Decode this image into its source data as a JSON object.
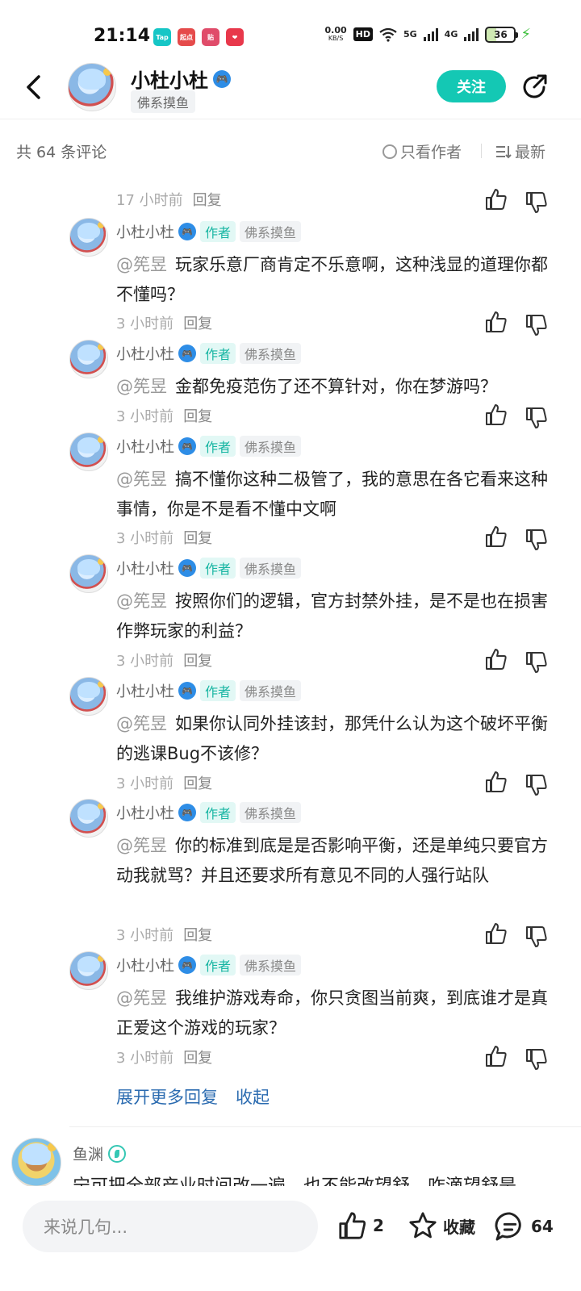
{
  "status_bar": {
    "time": "21:14",
    "apps": [
      {
        "name": "Tap",
        "color": "#16c6c6"
      },
      {
        "name": "起点",
        "color": "#e54b4b"
      },
      {
        "name": "贴",
        "color": "#e04c6a"
      },
      {
        "name": "❤",
        "color": "#e8384b"
      }
    ],
    "net_speed": "0.00",
    "net_speed_unit": "KB/S",
    "hd": "HD",
    "net1": "5G",
    "net2": "4G",
    "battery": "36"
  },
  "header": {
    "name": "小杜小杜",
    "tag": "佛系摸鱼",
    "follow_label": "关注"
  },
  "filter": {
    "count_label": "共 64 条评论",
    "only_author": "只看作者",
    "sort": "最新"
  },
  "top_meta": {
    "time": "17 小时前",
    "reply": "回复"
  },
  "replies": [
    {
      "name": "小杜小杜",
      "author_badge": "作者",
      "tag": "佛系摸鱼",
      "mention": "@筅昱",
      "text": "玩家乐意厂商肯定不乐意啊，这种浅显的道理你都不懂吗？",
      "time": "3 小时前",
      "reply": "回复"
    },
    {
      "name": "小杜小杜",
      "author_badge": "作者",
      "tag": "佛系摸鱼",
      "mention": "@筅昱",
      "text": "金都免疫范伤了还不算针对，你在梦游吗？",
      "time": "3 小时前",
      "reply": "回复"
    },
    {
      "name": "小杜小杜",
      "author_badge": "作者",
      "tag": "佛系摸鱼",
      "mention": "@筅昱",
      "text": "搞不懂你这种二极管了，我的意思在各它看来这种事情，你是不是看不懂中文啊",
      "time": "3 小时前",
      "reply": "回复"
    },
    {
      "name": "小杜小杜",
      "author_badge": "作者",
      "tag": "佛系摸鱼",
      "mention": "@筅昱",
      "text": "按照你们的逻辑，官方封禁外挂，是不是也在损害作弊玩家的利益？",
      "time": "3 小时前",
      "reply": "回复"
    },
    {
      "name": "小杜小杜",
      "author_badge": "作者",
      "tag": "佛系摸鱼",
      "mention": "@筅昱",
      "text": "如果你认同外挂该封，那凭什么认为这个破坏平衡的逃课Bug不该修？",
      "time": "3 小时前",
      "reply": "回复"
    },
    {
      "name": "小杜小杜",
      "author_badge": "作者",
      "tag": "佛系摸鱼",
      "mention": "@筅昱",
      "text": "你的标准到底是是否影响平衡，还是单纯只要官方动我就骂？并且还要求所有意见不同的人强行站队",
      "time": "3 小时前",
      "reply": "回复"
    },
    {
      "name": "小杜小杜",
      "author_badge": "作者",
      "tag": "佛系摸鱼",
      "mention": "@筅昱",
      "text": "我维护游戏寿命，你只贪图当前爽，到底谁才是真正爱这个游戏的玩家？",
      "time": "3 小时前",
      "reply": "回复"
    }
  ],
  "more": {
    "expand": "展开更多回复",
    "collapse": "收起"
  },
  "next_comment": {
    "name": "鱼渊",
    "text": "宁可把全部产业时间改一遍，也不能改望舒，咋滴望舒是"
  },
  "bottom": {
    "input_placeholder": "来说几句...",
    "likes": "2",
    "favorite": "收藏",
    "comments": "64"
  }
}
